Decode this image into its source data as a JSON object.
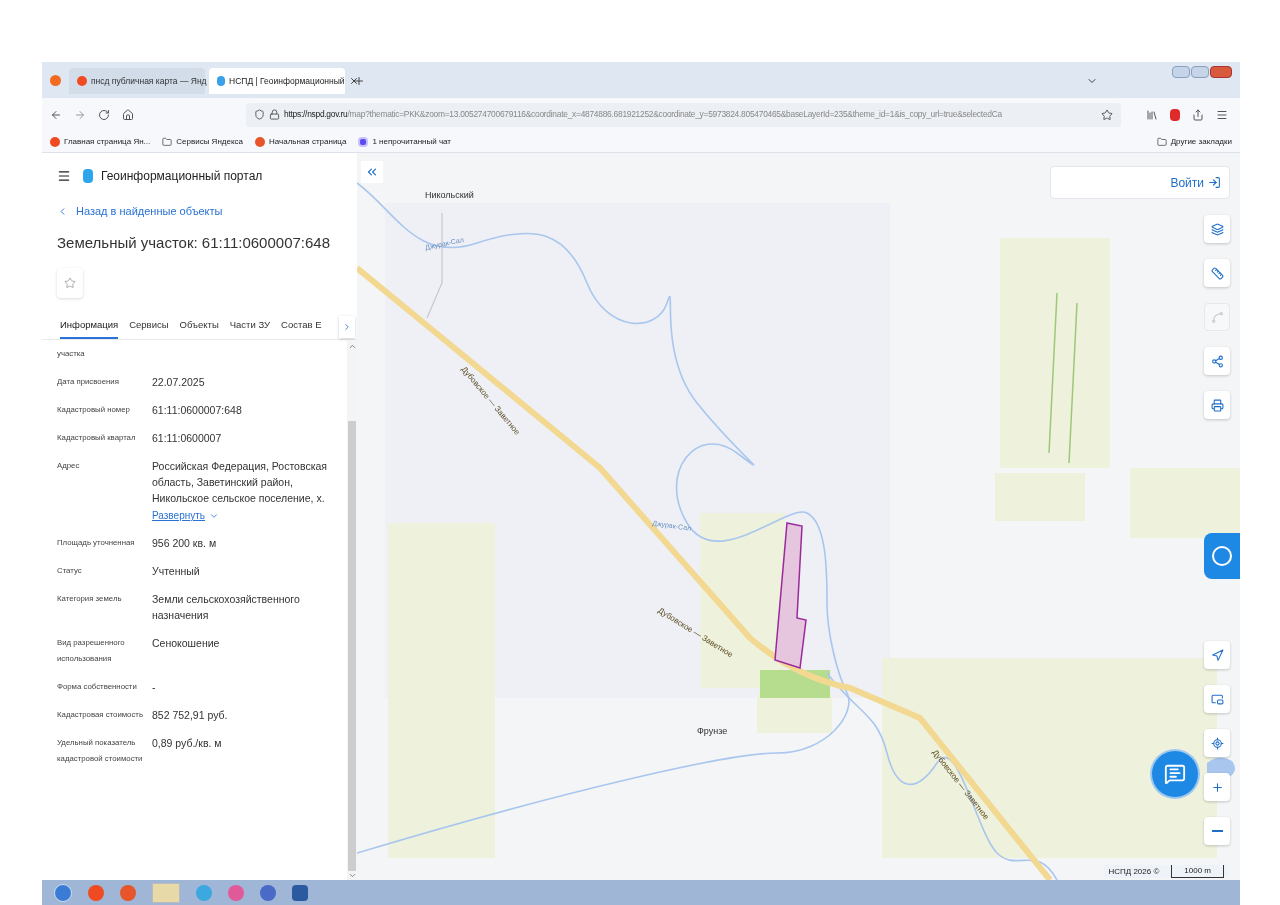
{
  "browser": {
    "tabs": [
      {
        "label": "пнсд публичная карта — Янд",
        "selected": false
      },
      {
        "label": "НСПД | Геоинформационный",
        "selected": true
      }
    ],
    "url_host": "https://nspd.gov.ru",
    "url_path": "/map?thematic=PKK&zoom=13.005274700679116&coordinate_x=4874886.681921252&coordinate_y=5973824.805470465&baseLayerId=235&theme_id=1&is_copy_url=true&selectedCa",
    "bookmarks": [
      {
        "label": "Главная страница Ян...",
        "kind": "yandex"
      },
      {
        "label": "Сервисы Яндекса",
        "kind": "folder"
      },
      {
        "label": "Начальная страница",
        "kind": "start"
      },
      {
        "label": "1 непрочитанный чат",
        "kind": "chat"
      }
    ],
    "other_bookmarks": "Другие закладки"
  },
  "portal": {
    "title": "Геоинформационный портал",
    "back_link": "Назад в найденные объекты",
    "object_title": "Земельный участок: 61:11:0600007:648",
    "favorite": false,
    "tabs": [
      {
        "label": "Информация",
        "selected": true
      },
      {
        "label": "Сервисы",
        "selected": false
      },
      {
        "label": "Объекты",
        "selected": false
      },
      {
        "label": "Части ЗУ",
        "selected": false
      },
      {
        "label": "Состав Е",
        "selected": false
      }
    ],
    "fields": [
      {
        "label": "участка"
      },
      {
        "label": "Дата присвоения",
        "value": "22.07.2025"
      },
      {
        "label": "Кадастровый номер",
        "value": "61:11:0600007:648"
      },
      {
        "label": "Кадастровый квартал",
        "value": "61:11:0600007"
      },
      {
        "label": "Адрес",
        "value": "Российская Федерация, Ростовская область, Заветинский район, Никольское сельское поселение, х.",
        "link": "Развернуть"
      },
      {
        "label": "Площадь уточненная",
        "value": "956 200 кв. м"
      },
      {
        "label": "Статус",
        "value": "Учтенный"
      },
      {
        "label": "Категория земель",
        "value": "Земли сельскохозяйственного назначения"
      },
      {
        "label": "Вид разрешенного использования",
        "value": "Сенокошение"
      },
      {
        "label": "Форма собственности",
        "value": "-"
      },
      {
        "label": "Кадастровая стоимость",
        "value": "852 752,91 руб."
      },
      {
        "label": "Удельный показатель кадастровой стоимости",
        "value": "0,89 руб./кв. м"
      }
    ]
  },
  "map": {
    "login": "Войти",
    "labels": [
      {
        "text": "Никольский",
        "kind": "place"
      },
      {
        "text": "Фрунзе",
        "kind": "place"
      },
      {
        "text": "Дубовское — Заветное",
        "kind": "road"
      },
      {
        "text": "Дубовское — Заветное",
        "kind": "road"
      },
      {
        "text": "Дубовское — Заветное",
        "kind": "road"
      },
      {
        "text": "Джурак-Сал",
        "kind": "river"
      },
      {
        "text": "Джурак-Сал",
        "kind": "river"
      }
    ],
    "tools": [
      {
        "kind": "layers",
        "disabled": false
      },
      {
        "kind": "ruler",
        "disabled": false
      },
      {
        "kind": "polygon",
        "disabled": true
      },
      {
        "kind": "share",
        "disabled": false
      },
      {
        "kind": "print",
        "disabled": false
      }
    ],
    "controls": [
      {
        "kind": "locate"
      },
      {
        "kind": "minimap"
      },
      {
        "kind": "geo"
      },
      {
        "kind": "zoom_in"
      },
      {
        "kind": "zoom_out"
      }
    ],
    "attribution": "НСПД 2026 ©",
    "scale": "1000 m"
  }
}
